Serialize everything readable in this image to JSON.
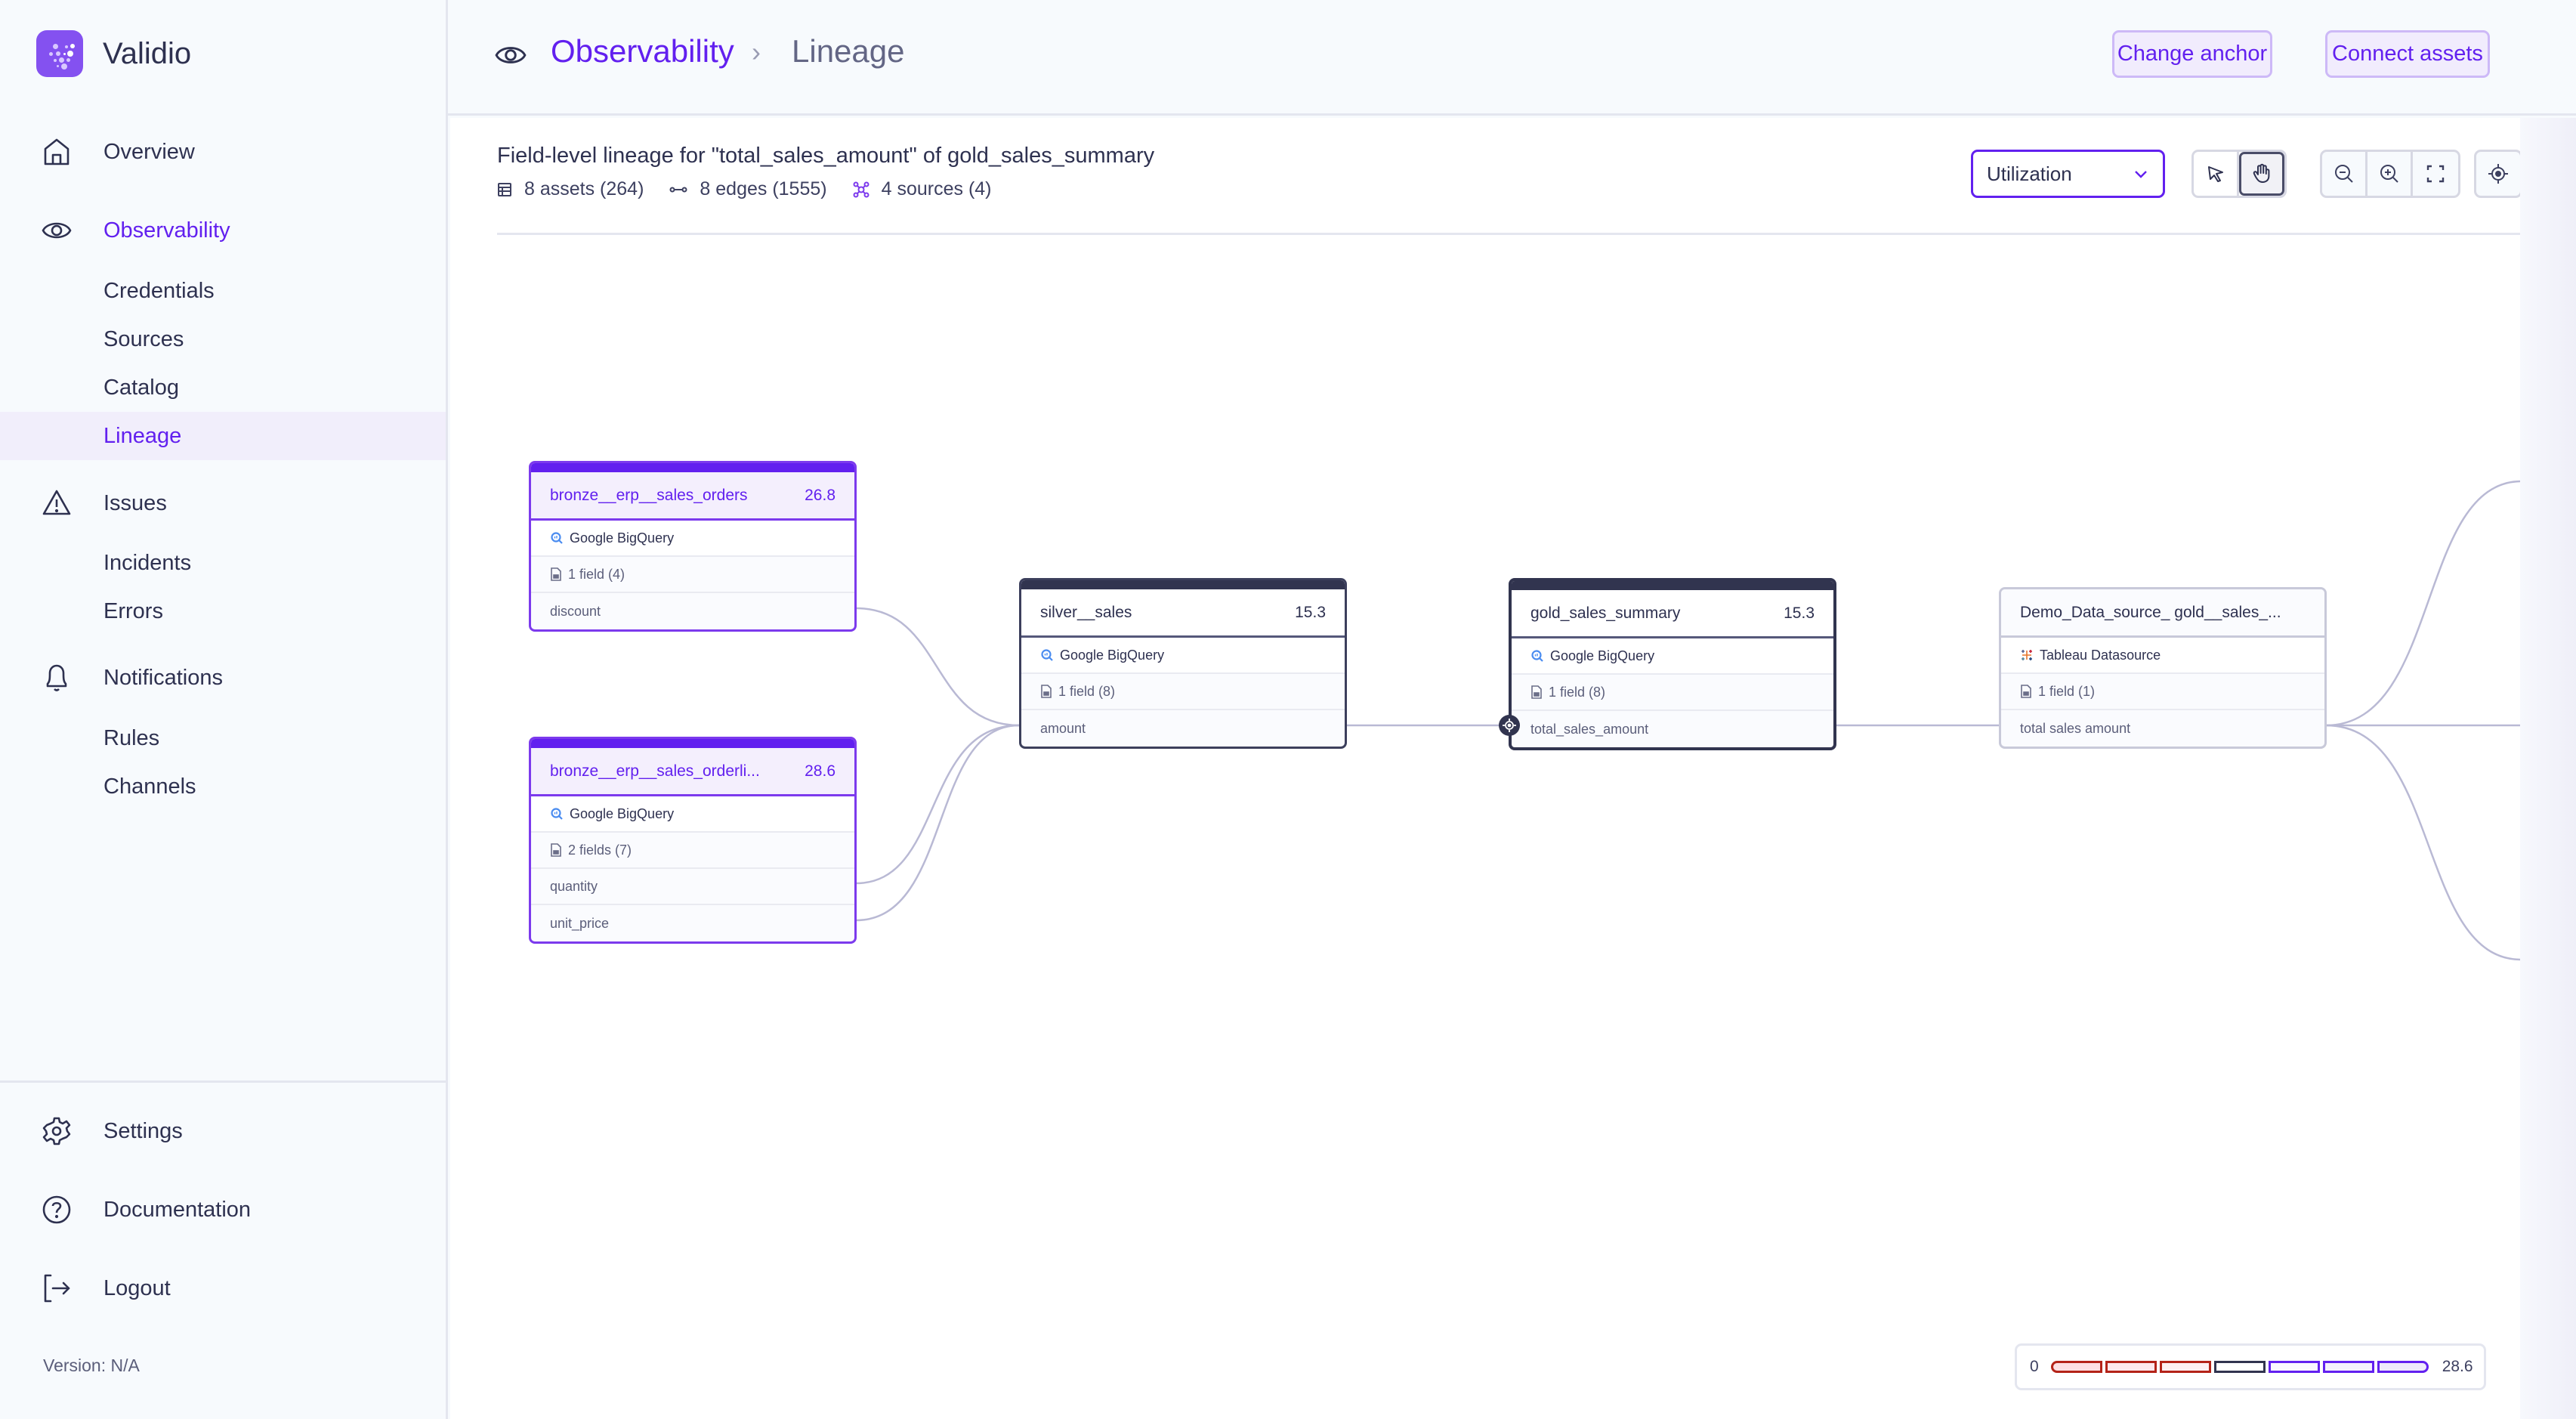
{
  "app": {
    "name": "Validio"
  },
  "sidebar": {
    "items": [
      {
        "label": "Overview",
        "icon": "home-icon"
      },
      {
        "label": "Observability",
        "icon": "eye-icon",
        "active": true,
        "children": [
          {
            "label": "Credentials"
          },
          {
            "label": "Sources"
          },
          {
            "label": "Catalog"
          },
          {
            "label": "Lineage",
            "selected": true
          }
        ]
      },
      {
        "label": "Issues",
        "icon": "warning-icon",
        "children": [
          {
            "label": "Incidents"
          },
          {
            "label": "Errors"
          }
        ]
      },
      {
        "label": "Notifications",
        "icon": "bell-icon",
        "children": [
          {
            "label": "Rules"
          },
          {
            "label": "Channels"
          }
        ]
      }
    ],
    "bottom": [
      {
        "label": "Settings",
        "icon": "gear-icon"
      },
      {
        "label": "Documentation",
        "icon": "help-circle-icon"
      },
      {
        "label": "Logout",
        "icon": "logout-icon"
      }
    ],
    "version": "Version: N/A"
  },
  "header": {
    "breadcrumb": {
      "section": "Observability",
      "separator": "›",
      "current": "Lineage"
    },
    "buttons": {
      "change_anchor": "Change anchor",
      "connect_assets": "Connect assets"
    }
  },
  "lineage": {
    "title": "Field-level lineage for \"total_sales_amount\" of gold_sales_summary",
    "meta": {
      "assets": "8 assets (264)",
      "edges": "8 edges (1555)",
      "sources": "4 sources (4)"
    },
    "view_select": {
      "value": "Utilization"
    },
    "tools": [
      "select-pointer",
      "pan-hand",
      "zoom-out",
      "zoom-in",
      "fit-view",
      "center-anchor"
    ],
    "active_tool": "pan-hand",
    "nodes": [
      {
        "id": "bronze_orders",
        "name": "bronze__erp__sales_orders",
        "score": "26.8",
        "source": "Google BigQuery",
        "fields_summary": "1 field (4)",
        "fields": [
          "discount"
        ]
      },
      {
        "id": "bronze_orderlines",
        "name": "bronze__erp__sales_orderli...",
        "score": "28.6",
        "source": "Google BigQuery",
        "fields_summary": "2 fields (7)",
        "fields": [
          "quantity",
          "unit_price"
        ]
      },
      {
        "id": "silver_sales",
        "name": "silver__sales",
        "score": "15.3",
        "source": "Google BigQuery",
        "fields_summary": "1 field (8)",
        "fields": [
          "amount"
        ]
      },
      {
        "id": "gold_summary",
        "name": "gold_sales_summary",
        "score": "15.3",
        "source": "Google BigQuery",
        "fields_summary": "1 field (8)",
        "fields": [
          "total_sales_amount"
        ],
        "anchor": true
      },
      {
        "id": "tableau_ds",
        "name": "Demo_Data_source_ gold__sales_...",
        "score": "",
        "source": "Tableau Datasource",
        "fields_summary": "1 field (1)",
        "fields": [
          "total sales amount"
        ]
      }
    ],
    "legend": {
      "min": "0",
      "max": "28.6",
      "colors": {
        "low": "#b42318",
        "mid": "#31344f",
        "high": "#6220ef"
      }
    }
  },
  "colors": {
    "accent": "#6220ef",
    "brand": "#8451f0",
    "text": "#2e3150",
    "edge": "#b9b9d4"
  }
}
